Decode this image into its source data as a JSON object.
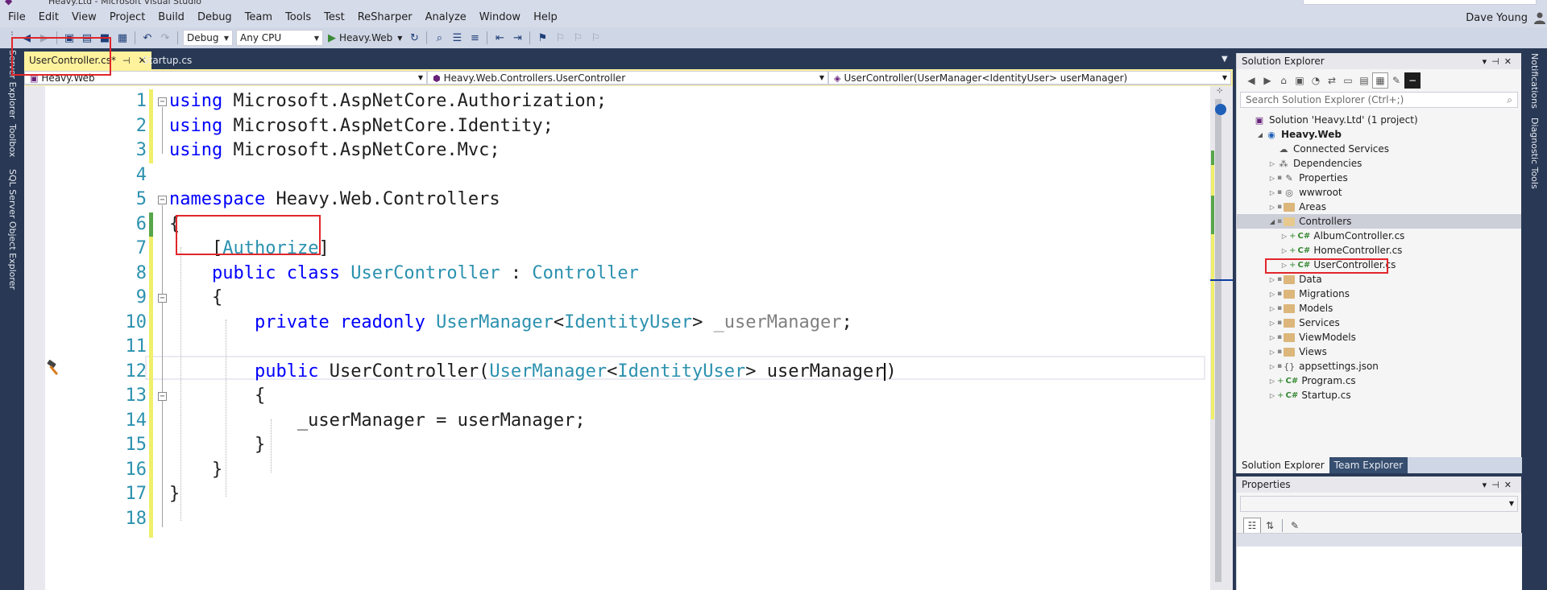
{
  "app": {
    "title": "Heavy.Ltd - Microsoft Visual Studio"
  },
  "menu": [
    "File",
    "Edit",
    "View",
    "Project",
    "Build",
    "Debug",
    "Team",
    "Tools",
    "Test",
    "ReSharper",
    "Analyze",
    "Window",
    "Help"
  ],
  "user": {
    "name": "Dave Young"
  },
  "toolbar": {
    "configuration": "Debug",
    "platform": "Any CPU",
    "startup_project": "Heavy.Web"
  },
  "left_tool_windows": [
    "Server Explorer",
    "Toolbox",
    "SQL Server Object Explorer"
  ],
  "right_tool_windows": [
    "Notifications",
    "Diagnostic Tools"
  ],
  "document_tabs": [
    {
      "label": "UserController.cs*",
      "active": true
    },
    {
      "label": "Startup.cs",
      "active": false
    }
  ],
  "nav_bar": {
    "project": "Heavy.Web",
    "type": "Heavy.Web.Controllers.UserController",
    "member": "UserController(UserManager<IdentityUser> userManager)"
  },
  "code": {
    "line_numbers": [
      "1",
      "2",
      "3",
      "4",
      "5",
      "6",
      "7",
      "8",
      "9",
      "10",
      "11",
      "12",
      "13",
      "14",
      "15",
      "16",
      "17",
      "18"
    ],
    "lines": [
      [
        {
          "t": "using",
          "c": "kw"
        },
        {
          "t": " Microsoft.AspNetCore.Authorization;"
        }
      ],
      [
        {
          "t": "using",
          "c": "kw"
        },
        {
          "t": " Microsoft.AspNetCore.Identity;"
        }
      ],
      [
        {
          "t": "using",
          "c": "kw"
        },
        {
          "t": " Microsoft.AspNetCore.Mvc;"
        }
      ],
      [],
      [
        {
          "t": "namespace",
          "c": "kw"
        },
        {
          "t": " Heavy.Web.Controllers"
        }
      ],
      [
        {
          "t": "{"
        }
      ],
      [
        {
          "t": "    ["
        },
        {
          "t": "Authorize",
          "c": "ty"
        },
        {
          "t": "]"
        }
      ],
      [
        {
          "t": "    "
        },
        {
          "t": "public",
          "c": "kw"
        },
        {
          "t": " "
        },
        {
          "t": "class",
          "c": "kw"
        },
        {
          "t": " "
        },
        {
          "t": "UserController",
          "c": "ty"
        },
        {
          "t": " : "
        },
        {
          "t": "Controller",
          "c": "ty"
        }
      ],
      [
        {
          "t": "    {"
        }
      ],
      [
        {
          "t": "        "
        },
        {
          "t": "private",
          "c": "kw"
        },
        {
          "t": " "
        },
        {
          "t": "readonly",
          "c": "kw"
        },
        {
          "t": " "
        },
        {
          "t": "UserManager",
          "c": "ty"
        },
        {
          "t": "<"
        },
        {
          "t": "IdentityUser",
          "c": "ty"
        },
        {
          "t": "> "
        },
        {
          "t": "_userManager",
          "c": "fd"
        },
        {
          "t": ";"
        }
      ],
      [],
      [
        {
          "t": "        "
        },
        {
          "t": "public",
          "c": "kw"
        },
        {
          "t": " UserController("
        },
        {
          "t": "UserManager",
          "c": "ty"
        },
        {
          "t": "<"
        },
        {
          "t": "IdentityUser",
          "c": "ty"
        },
        {
          "t": "> userManager"
        },
        {
          "t": "",
          "c": "caret"
        },
        {
          "t": ")"
        }
      ],
      [
        {
          "t": "        {"
        }
      ],
      [
        {
          "t": "            _userManager = userManager;"
        }
      ],
      [
        {
          "t": "        }"
        }
      ],
      [
        {
          "t": "    }"
        }
      ],
      [
        {
          "t": "}"
        }
      ],
      []
    ]
  },
  "solution_explorer": {
    "title": "Solution Explorer",
    "search_placeholder": "Search Solution Explorer (Ctrl+;)",
    "items": [
      {
        "label": "Solution 'Heavy.Ltd' (1 project)",
        "depth": 0,
        "icon": "solution",
        "twisty": "",
        "bold": false
      },
      {
        "label": "Heavy.Web",
        "depth": 1,
        "icon": "web-project",
        "twisty": "down",
        "bold": true
      },
      {
        "label": "Connected Services",
        "depth": 2,
        "icon": "cloud",
        "twisty": "",
        "bold": false
      },
      {
        "label": "Dependencies",
        "depth": 2,
        "icon": "dependencies",
        "twisty": "right",
        "bold": false
      },
      {
        "label": "Properties",
        "depth": 2,
        "icon": "wrench",
        "twisty": "right",
        "bold": false,
        "lock": true
      },
      {
        "label": "wwwroot",
        "depth": 2,
        "icon": "globe",
        "twisty": "right",
        "bold": false,
        "lock": true
      },
      {
        "label": "Areas",
        "depth": 2,
        "icon": "folder",
        "twisty": "right",
        "bold": false,
        "lock": true
      },
      {
        "label": "Controllers",
        "depth": 2,
        "icon": "folder-open",
        "twisty": "down",
        "bold": false,
        "lock": true,
        "selected": true
      },
      {
        "label": "AlbumController.cs",
        "depth": 3,
        "icon": "cs",
        "twisty": "right",
        "bold": false,
        "plus": true
      },
      {
        "label": "HomeController.cs",
        "depth": 3,
        "icon": "cs",
        "twisty": "right",
        "bold": false,
        "plus": true
      },
      {
        "label": "UserController.cs",
        "depth": 3,
        "icon": "cs",
        "twisty": "right",
        "bold": false,
        "plus": true
      },
      {
        "label": "Data",
        "depth": 2,
        "icon": "folder",
        "twisty": "right",
        "bold": false,
        "lock": true
      },
      {
        "label": "Migrations",
        "depth": 2,
        "icon": "folder",
        "twisty": "right",
        "bold": false,
        "lock": true
      },
      {
        "label": "Models",
        "depth": 2,
        "icon": "folder",
        "twisty": "right",
        "bold": false,
        "lock": true
      },
      {
        "label": "Services",
        "depth": 2,
        "icon": "folder",
        "twisty": "right",
        "bold": false,
        "lock": true
      },
      {
        "label": "ViewModels",
        "depth": 2,
        "icon": "folder",
        "twisty": "right",
        "bold": false,
        "lock": true
      },
      {
        "label": "Views",
        "depth": 2,
        "icon": "folder",
        "twisty": "right",
        "bold": false,
        "lock": true
      },
      {
        "label": "appsettings.json",
        "depth": 2,
        "icon": "json",
        "twisty": "right",
        "bold": false,
        "lock": true
      },
      {
        "label": "Program.cs",
        "depth": 2,
        "icon": "cs",
        "twisty": "right",
        "bold": false,
        "plus": true
      },
      {
        "label": "Startup.cs",
        "depth": 2,
        "icon": "cs",
        "twisty": "right",
        "bold": false,
        "plus": true
      }
    ],
    "tabs": [
      "Solution Explorer",
      "Team Explorer"
    ]
  },
  "properties": {
    "title": "Properties"
  },
  "colors": {
    "keyword": "#0000ff",
    "type": "#2b91af",
    "highlight": "#e0262a",
    "active_tab": "#fff29d"
  }
}
